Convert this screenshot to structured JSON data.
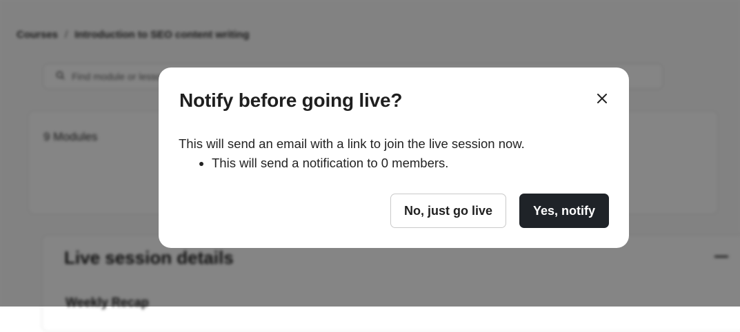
{
  "background": {
    "breadcrumb": [
      "Courses",
      "Introduction to SEO content writing"
    ],
    "breadcrumb_separator": "/",
    "search": {
      "placeholder": "Find module or lesson"
    },
    "modules": {
      "count_label": "9 Modules"
    },
    "live_session": {
      "title": "Live session details",
      "subtitle": "Weekly Recap"
    }
  },
  "modal": {
    "title": "Notify before going live?",
    "description": "This will send an email with a link to join the live session now.",
    "bullets": [
      "This will send a notification to 0 members."
    ],
    "close_icon": "close-icon",
    "secondary_button": "No, just go live",
    "primary_button": "Yes, notify"
  },
  "colors": {
    "overlay": "rgba(0,0,0,0.48)",
    "primary_button_bg": "#1f2328",
    "primary_button_text": "#ffffff",
    "modal_bg": "#ffffff"
  }
}
